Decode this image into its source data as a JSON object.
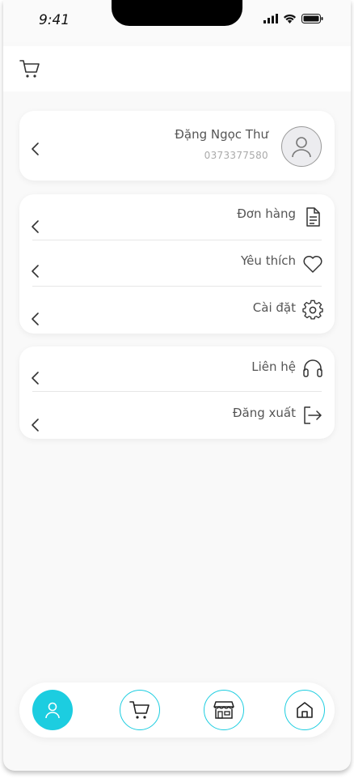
{
  "status_bar": {
    "time": "9:41"
  },
  "header": {
    "cart_icon": "cart-icon"
  },
  "profile": {
    "name": "Đặng Ngọc Thư",
    "phone": "0373377580",
    "avatar_icon": "user-icon"
  },
  "menu_group_1": [
    {
      "label": "Đơn hàng",
      "icon": "document-icon"
    },
    {
      "label": "Yêu thích",
      "icon": "heart-icon"
    },
    {
      "label": "Cài đặt",
      "icon": "gear-icon"
    }
  ],
  "menu_group_2": [
    {
      "label": "Liên hệ",
      "icon": "headset-icon"
    },
    {
      "label": "Đăng xuất",
      "icon": "logout-icon"
    }
  ],
  "bottom_nav": [
    {
      "icon": "user-icon",
      "active": true
    },
    {
      "icon": "cart-icon",
      "active": false
    },
    {
      "icon": "store-icon",
      "active": false
    },
    {
      "icon": "home-icon",
      "active": false
    }
  ],
  "colors": {
    "accent": "#1ccde0",
    "text": "#555555",
    "muted": "#aaaaaa"
  }
}
